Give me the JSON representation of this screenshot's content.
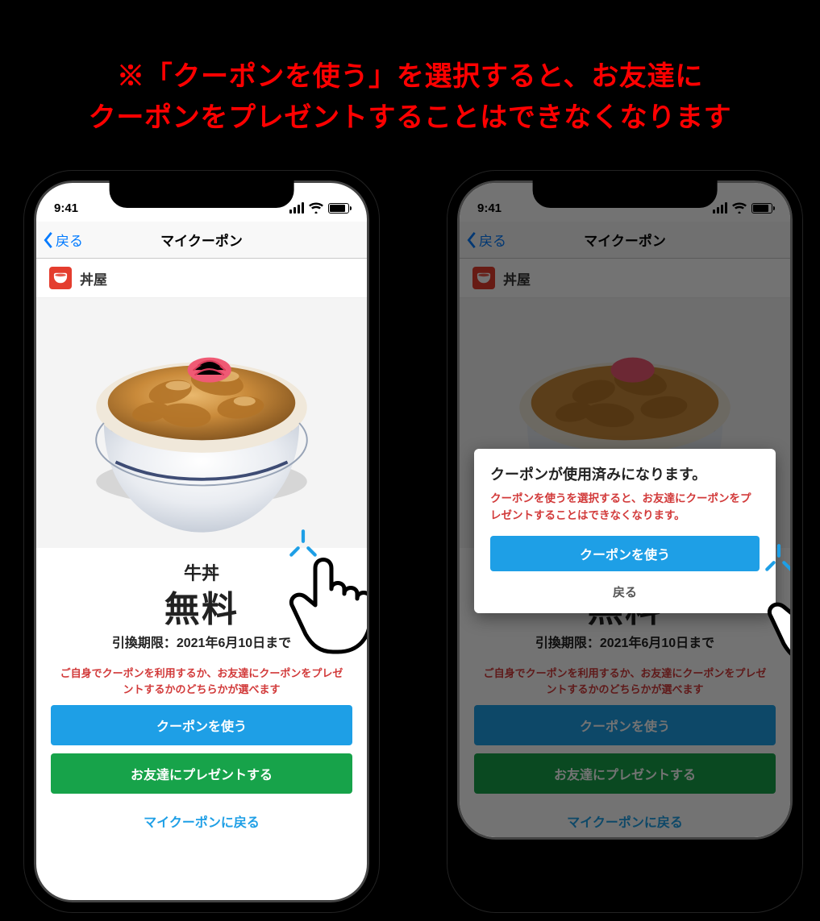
{
  "caption_line1": "※「クーポンを使う」を選択すると、お友達に",
  "caption_line2": "クーポンをプレゼントすることはできなくなります",
  "statusbar": {
    "time": "9:41"
  },
  "nav": {
    "back": "戻る",
    "title": "マイクーポン"
  },
  "shop": {
    "name": "丼屋"
  },
  "coupon": {
    "item_name": "牛丼",
    "price_label": "無料",
    "expiry_prefix": "引換期限：",
    "expiry_value": "2021年6月10日まで"
  },
  "note": "ご自身でクーポンを利用するか、お友達にクーポンをプレゼントするかのどちらかが選べます",
  "buttons": {
    "use": "クーポンを使う",
    "gift": "お友達にプレゼントする",
    "back_to_list": "マイクーポンに戻る"
  },
  "modal": {
    "title": "クーポンが使用済みになります。",
    "warning": "クーポンを使うを選択すると、お友達にクーポンをプレゼントすることはできなくなります。",
    "confirm": "クーポンを使う",
    "cancel": "戻る"
  }
}
